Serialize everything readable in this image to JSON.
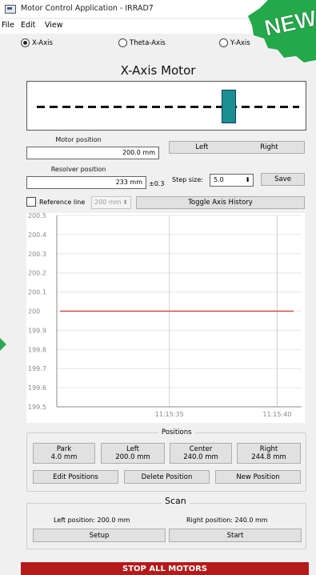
{
  "window": {
    "title": "Motor Control Application - IRRAD7"
  },
  "menu": [
    "File",
    "Edit",
    "View"
  ],
  "axes": [
    {
      "label": "X-Axis",
      "selected": true
    },
    {
      "label": "Theta-Axis",
      "selected": false
    },
    {
      "label": "Y-Axis",
      "selected": false
    }
  ],
  "badge": {
    "text": "NEW"
  },
  "motor": {
    "heading": "X-Axis Motor",
    "motor_position_label": "Motor position",
    "motor_position_value": "200.0 mm",
    "resolver_position_label": "Resolver position",
    "resolver_position_value": "233 mm",
    "resolver_tolerance": "±0.3",
    "left_label": "Left",
    "right_label": "Right",
    "step_size_label": "Step size:",
    "step_size_value": "5.0",
    "save_label": "Save",
    "reference_line_label": "Reference line",
    "reference_line_value": "200 mm",
    "toggle_history_label": "Toggle Axis History",
    "carriage_fraction": 0.75
  },
  "chart_data": {
    "type": "line",
    "y_ticks": [
      "200.5",
      "200.4",
      "200.3",
      "200.2",
      "200.1",
      "200",
      "199.9",
      "199.8",
      "199.7",
      "199.6",
      "199.5"
    ],
    "ylim": [
      199.5,
      200.5
    ],
    "x_ticks": [
      "11:15:35",
      "11:15:40"
    ],
    "series": [
      {
        "values": [
          200,
          200
        ]
      }
    ],
    "line_color": "#d22b2b",
    "grid": true
  },
  "positions": {
    "title": "Positions",
    "items": [
      {
        "name": "Park",
        "value": "4.0 mm"
      },
      {
        "name": "Left",
        "value": "200.0 mm"
      },
      {
        "name": "Center",
        "value": "240.0 mm"
      },
      {
        "name": "Right",
        "value": "244.8 mm"
      }
    ],
    "edit_label": "Edit Positions",
    "delete_label": "Delete Position",
    "new_label": "New Position"
  },
  "scan": {
    "title": "Scan",
    "left_position": "Left position: 200.0 mm",
    "right_position": "Right position: 240.0 mm",
    "setup_label": "Setup",
    "start_label": "Start"
  },
  "stop": {
    "label": "STOP ALL MOTORS"
  }
}
